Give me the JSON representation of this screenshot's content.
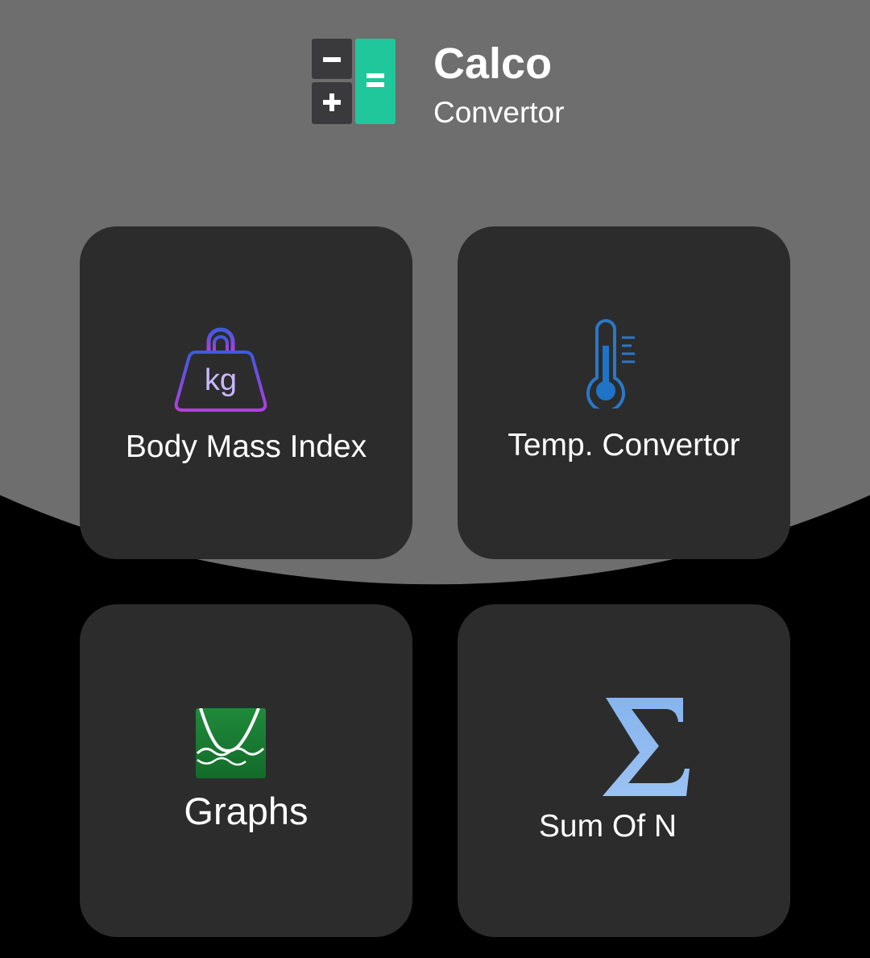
{
  "header": {
    "title": "Calco",
    "subtitle": "Convertor",
    "logo_icon": "calculator-logo-icon"
  },
  "colors": {
    "background": "#000000",
    "header_arc": "#6e6e6e",
    "card": "#2c2c2c",
    "logo_dark": "#3a3a3c",
    "logo_green": "#1fc79a",
    "text": "#ffffff"
  },
  "cards": [
    {
      "label": "Body Mass Index",
      "icon": "weight-kg-icon",
      "icon_text": "kg"
    },
    {
      "label": "Temp. Convertor",
      "icon": "thermometer-icon"
    },
    {
      "label": "Graphs",
      "icon": "graph-icon"
    },
    {
      "label": "Sum Of N",
      "icon": "sigma-icon"
    }
  ]
}
